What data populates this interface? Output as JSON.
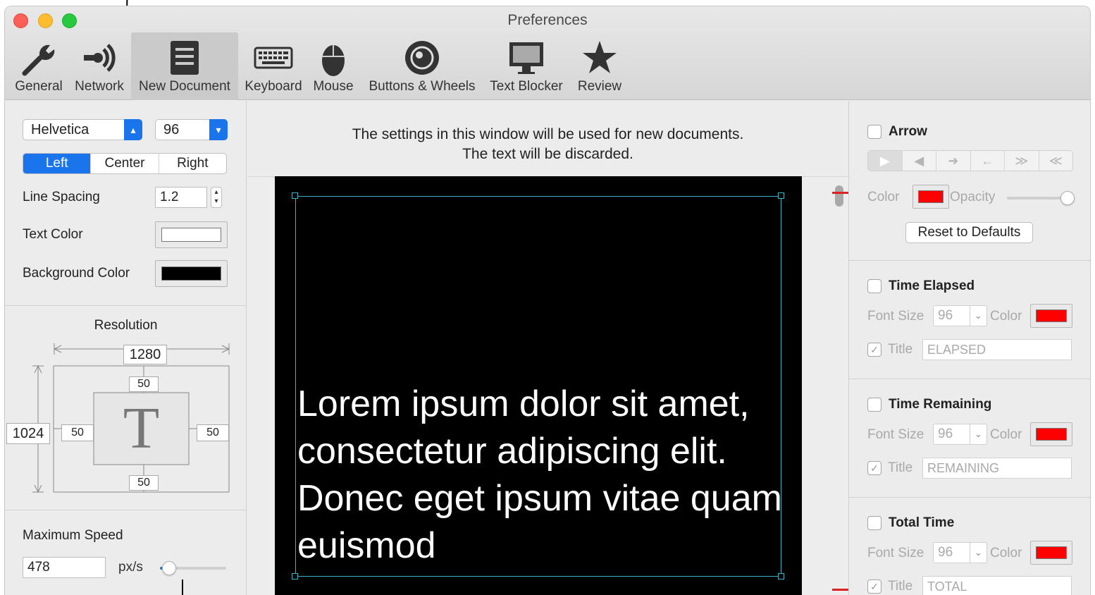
{
  "window": {
    "title": "Preferences"
  },
  "toolbar": {
    "items": [
      {
        "label": "General",
        "icon": "wrench-icon"
      },
      {
        "label": "Network",
        "icon": "network-icon"
      },
      {
        "label": "New Document",
        "icon": "document-icon",
        "selected": true
      },
      {
        "label": "Keyboard",
        "icon": "keyboard-icon"
      },
      {
        "label": "Mouse",
        "icon": "mouse-icon"
      },
      {
        "label": "Buttons & Wheels",
        "icon": "wheel-icon"
      },
      {
        "label": "Text Blocker",
        "icon": "monitor-icon"
      },
      {
        "label": "Review",
        "icon": "star-icon"
      }
    ]
  },
  "left": {
    "font_family": "Helvetica",
    "font_size": "96",
    "align": {
      "left": "Left",
      "center": "Center",
      "right": "Right",
      "selected": "Left"
    },
    "line_spacing_label": "Line Spacing",
    "line_spacing_value": "1.2",
    "text_color_label": "Text Color",
    "text_color": "#ffffff",
    "background_color_label": "Background Color",
    "background_color": "#000000",
    "resolution_label": "Resolution",
    "width": "1280",
    "height": "1024",
    "margin_top": "50",
    "margin_left": "50",
    "margin_right": "50",
    "margin_bottom": "50",
    "preview_glyph": "T",
    "max_speed_label": "Maximum Speed",
    "max_speed_value": "478",
    "speed_unit": "px/s",
    "speed_slider_fraction": 0.08
  },
  "center": {
    "hint_line1": "The settings in this window will be used for new documents.",
    "hint_line2": "The text will be discarded.",
    "sample_text": "Lorem ipsum dolor sit amet, consectetur adipiscing elit. Donec eget ipsum vitae quam euismod"
  },
  "right": {
    "arrow": {
      "title": "Arrow",
      "checked": false,
      "styles": [
        "▶",
        "◀",
        "➜",
        "←",
        "≫",
        "≪"
      ],
      "color_label": "Color",
      "color": "#ff0000",
      "opacity_label": "Opacity",
      "opacity_fraction": 1.0,
      "reset_label": "Reset to Defaults"
    },
    "elapsed": {
      "title": "Time Elapsed",
      "font_size_label": "Font Size",
      "font_size": "96",
      "color_label": "Color",
      "title_label": "Title",
      "title_value": "ELAPSED"
    },
    "remaining": {
      "title": "Time Remaining",
      "font_size_label": "Font Size",
      "font_size": "96",
      "color_label": "Color",
      "title_label": "Title",
      "title_value": "REMAINING"
    },
    "total": {
      "title": "Total Time",
      "font_size_label": "Font Size",
      "font_size": "96",
      "color_label": "Color",
      "title_label": "Title",
      "title_value": "TOTAL"
    },
    "accent_color": "#ff0000"
  }
}
